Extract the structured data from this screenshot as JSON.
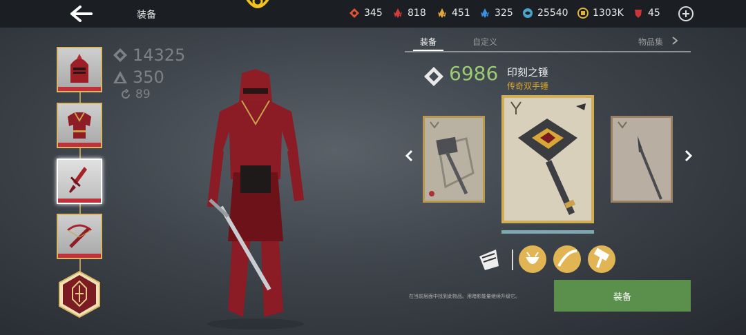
{
  "header": {
    "title": "装备",
    "resources": [
      {
        "name": "orange-shard",
        "value": "345",
        "color": "#e0553a"
      },
      {
        "name": "red-crystal",
        "value": "818",
        "color": "#d43b3b"
      },
      {
        "name": "gold-crystal",
        "value": "451",
        "color": "#e0a83a"
      },
      {
        "name": "blue-crystal",
        "value": "325",
        "color": "#3a8fe0"
      },
      {
        "name": "soul-orb",
        "value": "25540",
        "color": "#4aa5c8"
      },
      {
        "name": "coins",
        "value": "1303K",
        "color": "#e2b23c"
      },
      {
        "name": "ruby-gem",
        "value": "45",
        "color": "#c8363a"
      }
    ]
  },
  "stats": {
    "power": "14325",
    "level": "350",
    "upgrades": "89"
  },
  "equipment_slots": [
    {
      "slot": "helmet",
      "selected": false
    },
    {
      "slot": "armor",
      "selected": false
    },
    {
      "slot": "weapon",
      "selected": true
    },
    {
      "slot": "ranged",
      "selected": false
    },
    {
      "slot": "magic",
      "selected": false
    }
  ],
  "tabs": [
    {
      "label": "装备",
      "active": true
    },
    {
      "label": "自定义",
      "active": false
    },
    {
      "label": "物品集",
      "active": false
    }
  ],
  "item": {
    "power": "6986",
    "name": "印刻之锤",
    "rarity": "传奇双手锤",
    "rarity_color": "#d8a42c"
  },
  "footer": {
    "hint": "在当前层面中找到此物品。用暗影能量继续升级它。",
    "equip_label": "装备"
  },
  "colors": {
    "power_green": "#9ccc72",
    "equip_button": "#5b8f4c"
  }
}
